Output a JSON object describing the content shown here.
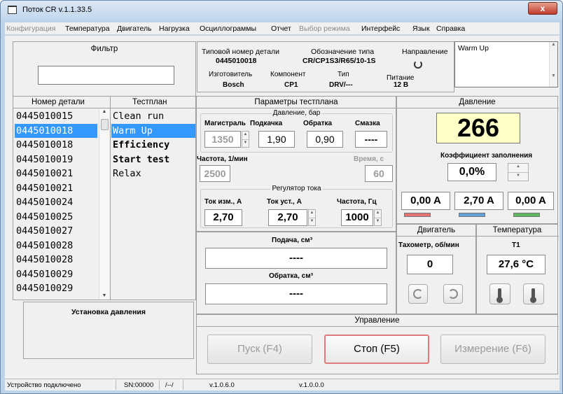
{
  "window": {
    "title": "Поток CR v.1.1.33.5",
    "close": "x"
  },
  "menu": [
    "Конфигурация",
    "Температура",
    "Двигатель",
    "Нагрузка",
    "Осциллограммы",
    "Отчет",
    "Выбор режима",
    "Интерфейс",
    "Язык",
    "Справка"
  ],
  "filter": {
    "title": "Фильтр",
    "value": ""
  },
  "part_info": {
    "type_number_label": "Типовой номер детали",
    "type_number": "0445010018",
    "designation_label": "Обозначение типа",
    "designation": "CR/CP1S3/R65/10-1S",
    "direction_label": "Направление",
    "manufacturer_label": "Изготовитель",
    "manufacturer": "Bosch",
    "component_label": "Компонент",
    "component": "CP1",
    "type_label": "Тип",
    "type": "DRV/---",
    "power_label": "Питание",
    "power": "12 В"
  },
  "notes": {
    "text": "Warm Up"
  },
  "part_list": {
    "header": "Номер детали",
    "items": [
      "0445010015",
      "0445010018",
      "0445010018",
      "0445010019",
      "0445010021",
      "0445010021",
      "0445010024",
      "0445010025",
      "0445010027",
      "0445010028",
      "0445010028",
      "0445010029",
      "0445010029"
    ],
    "selected": 1
  },
  "testplan": {
    "header": "Тестплан",
    "items": [
      "Clean run",
      "Warm Up",
      "Efficiency",
      "Start test",
      "Relax"
    ],
    "selected": 1
  },
  "params": {
    "title": "Параметры тестплана",
    "pressure_group": "Давление, бар",
    "rail_label": "Магистраль",
    "rail": "1350",
    "pump_label": "Подкачка",
    "pump": "1,90",
    "return_label": "Обратка",
    "return": "0,90",
    "lube_label": "Смазка",
    "lube": "----",
    "freq_label": "Частота, 1/мин",
    "freq": "2500",
    "time_label": "Время, с",
    "time": "60",
    "current_group": "Регулятор тока",
    "cur_meas_label": "Ток изм., А",
    "cur_meas": "2,70",
    "cur_set_label": "Ток уст., А",
    "cur_set": "2,70",
    "cur_freq_label": "Частота, Гц",
    "cur_freq": "1000"
  },
  "flow": {
    "supply_label": "Подача, см³",
    "supply": "----",
    "return_label": "Обратка, см³",
    "return": "----"
  },
  "install": {
    "title": "Установка давления"
  },
  "pressure": {
    "title": "Давление",
    "value": "266",
    "duty_label": "Коэффициент заполнения",
    "duty": "0,0%",
    "currents": [
      "0,00 A",
      "2,70 A",
      "0,00 A"
    ],
    "colors": [
      "#e57373",
      "#64a0dc",
      "#5cb85c"
    ]
  },
  "motor": {
    "title": "Двигатель",
    "tacho_label": "Тахометр, об/мин",
    "tacho": "0"
  },
  "temperature": {
    "title": "Температура",
    "sensor": "T1",
    "value": "27,6 °C"
  },
  "control": {
    "title": "Управление",
    "start": "Пуск (F4)",
    "stop": "Стоп (F5)",
    "measure": "Измерение (F6)"
  },
  "status": {
    "device": "Устройство подключено",
    "sn": "SN:00000",
    "mode": "/--/",
    "v1": "v.1.0.6.0",
    "v2": "v.1.0.0.0"
  }
}
